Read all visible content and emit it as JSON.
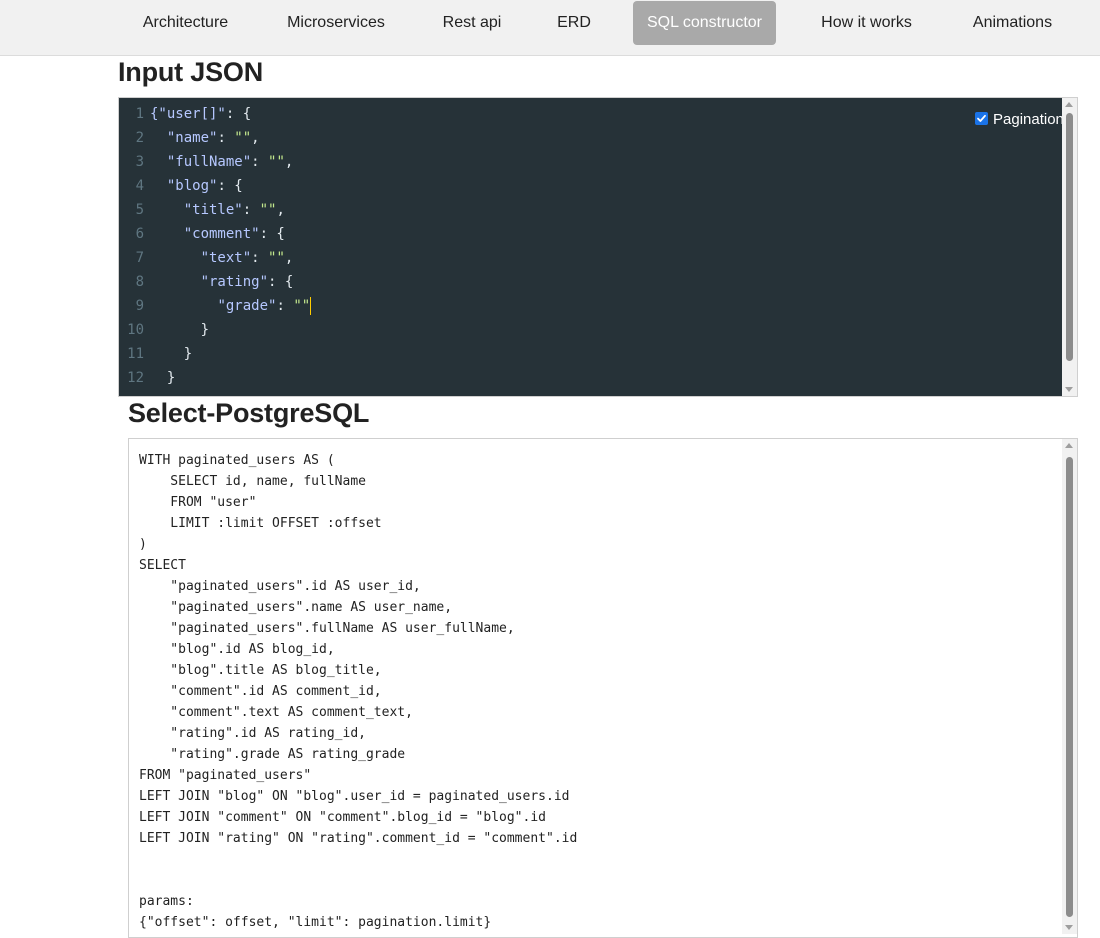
{
  "nav": {
    "tabs": [
      {
        "label": "Architecture",
        "active": false
      },
      {
        "label": "Microservices",
        "active": false
      },
      {
        "label": "Rest api",
        "active": false
      },
      {
        "label": "ERD",
        "active": false
      },
      {
        "label": "SQL constructor",
        "active": true
      },
      {
        "label": "How it works",
        "active": false
      },
      {
        "label": "Animations",
        "active": false
      }
    ]
  },
  "input_section": {
    "title": "Input JSON",
    "pagination_label": "Pagination",
    "pagination_checked": true,
    "line_numbers": [
      "1",
      "2",
      "3",
      "4",
      "5",
      "6",
      "7",
      "8",
      "9",
      "10",
      "11",
      "12"
    ],
    "lines": [
      [
        {
          "t": "key",
          "v": "{\"user[]\""
        },
        {
          "t": "punc",
          "v": ": {"
        }
      ],
      [
        {
          "t": "ind",
          "v": "  "
        },
        {
          "t": "key",
          "v": "\"name\""
        },
        {
          "t": "punc",
          "v": ": "
        },
        {
          "t": "str",
          "v": "\"\""
        },
        {
          "t": "punc",
          "v": ","
        }
      ],
      [
        {
          "t": "ind",
          "v": "  "
        },
        {
          "t": "key",
          "v": "\"fullName\""
        },
        {
          "t": "punc",
          "v": ": "
        },
        {
          "t": "str",
          "v": "\"\""
        },
        {
          "t": "punc",
          "v": ","
        }
      ],
      [
        {
          "t": "ind",
          "v": "  "
        },
        {
          "t": "key",
          "v": "\"blog\""
        },
        {
          "t": "punc",
          "v": ": {"
        }
      ],
      [
        {
          "t": "ind",
          "v": "    "
        },
        {
          "t": "key",
          "v": "\"title\""
        },
        {
          "t": "punc",
          "v": ": "
        },
        {
          "t": "str",
          "v": "\"\""
        },
        {
          "t": "punc",
          "v": ","
        }
      ],
      [
        {
          "t": "ind",
          "v": "    "
        },
        {
          "t": "key",
          "v": "\"comment\""
        },
        {
          "t": "punc",
          "v": ": {"
        }
      ],
      [
        {
          "t": "ind",
          "v": "      "
        },
        {
          "t": "key",
          "v": "\"text\""
        },
        {
          "t": "punc",
          "v": ": "
        },
        {
          "t": "str",
          "v": "\"\""
        },
        {
          "t": "punc",
          "v": ","
        }
      ],
      [
        {
          "t": "ind",
          "v": "      "
        },
        {
          "t": "key",
          "v": "\"rating\""
        },
        {
          "t": "punc",
          "v": ": {"
        }
      ],
      [
        {
          "t": "ind",
          "v": "        "
        },
        {
          "t": "key",
          "v": "\"grade\""
        },
        {
          "t": "punc",
          "v": ": "
        },
        {
          "t": "str",
          "v": "\"\""
        },
        {
          "t": "caret",
          "v": ""
        }
      ],
      [
        {
          "t": "ind",
          "v": "      "
        },
        {
          "t": "punc",
          "v": "}"
        }
      ],
      [
        {
          "t": "ind",
          "v": "    "
        },
        {
          "t": "punc",
          "v": "}"
        }
      ],
      [
        {
          "t": "ind",
          "v": "  "
        },
        {
          "t": "punc",
          "v": "}"
        }
      ]
    ]
  },
  "output_section": {
    "title": "Select-PostgreSQL",
    "sql": "WITH paginated_users AS (\n    SELECT id, name, fullName\n    FROM \"user\"\n    LIMIT :limit OFFSET :offset\n)\nSELECT\n    \"paginated_users\".id AS user_id,\n    \"paginated_users\".name AS user_name,\n    \"paginated_users\".fullName AS user_fullName,\n    \"blog\".id AS blog_id,\n    \"blog\".title AS blog_title,\n    \"comment\".id AS comment_id,\n    \"comment\".text AS comment_text,\n    \"rating\".id AS rating_id,\n    \"rating\".grade AS rating_grade\nFROM \"paginated_users\"\nLEFT JOIN \"blog\" ON \"blog\".user_id = paginated_users.id\nLEFT JOIN \"comment\" ON \"comment\".blog_id = \"blog\".id\nLEFT JOIN \"rating\" ON \"rating\".comment_id = \"comment\".id\n\n\nparams:\n{\"offset\": offset, \"limit\": pagination.limit}"
  },
  "colors": {
    "editor_bg": "#263238",
    "active_tab": "#a9a9a9",
    "json_key": "#b6c8ff",
    "json_string": "#c3e88d",
    "caret": "#ffcc00"
  }
}
